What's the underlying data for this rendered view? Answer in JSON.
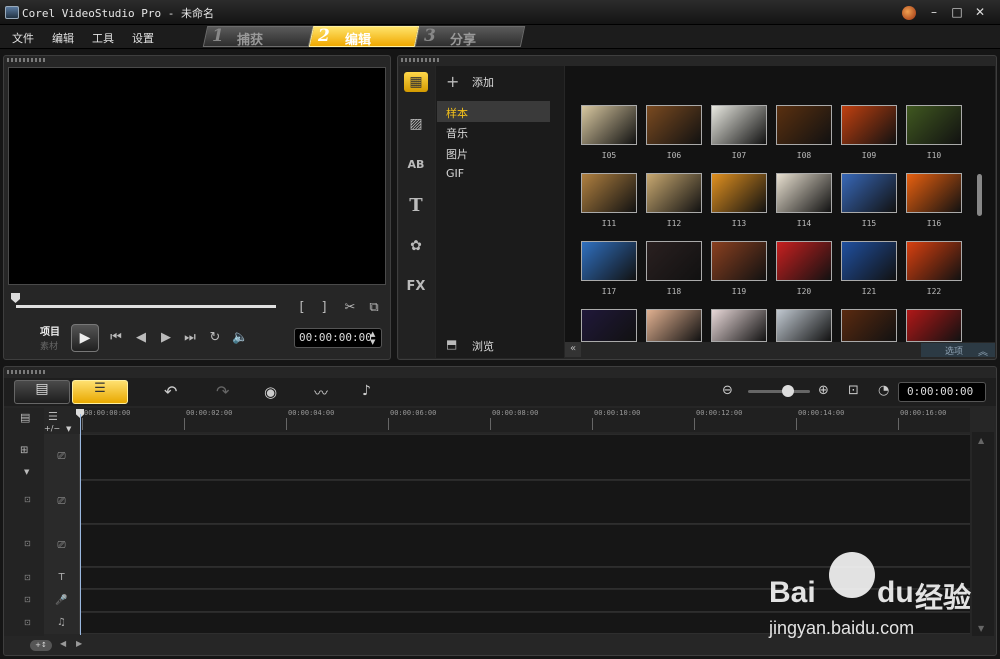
{
  "window": {
    "title": "Corel VideoStudio Pro - 未命名",
    "minimize": "–",
    "maximize": "□",
    "close": "✕"
  },
  "menu": [
    "文件",
    "编辑",
    "工具",
    "设置"
  ],
  "steps": [
    {
      "num": "1",
      "label": "捕获",
      "active": false
    },
    {
      "num": "2",
      "label": "编辑",
      "active": true
    },
    {
      "num": "3",
      "label": "分享",
      "active": false
    }
  ],
  "preview": {
    "mode_project": "项目",
    "mode_clip": "素材",
    "timecode": "00:00:00:00",
    "icons": [
      "play-icon",
      "home-icon",
      "prev-frame-icon",
      "next-frame-icon",
      "end-icon",
      "repeat-icon",
      "volume-icon",
      "mark-in-icon",
      "mark-out-icon",
      "split-icon",
      "copy-icon"
    ]
  },
  "library": {
    "add_label": "添加",
    "browse_label": "浏览",
    "options_label": "选项",
    "items": [
      "样本",
      "音乐",
      "图片",
      "GIF"
    ],
    "selected_item": "样本",
    "side_icons": [
      "media-icon",
      "transition-icon",
      "title-ab-icon",
      "text-t-icon",
      "graphic-icon",
      "fx-icon"
    ],
    "thumbnails": [
      {
        "label": "I05",
        "color": "#d8c8a0"
      },
      {
        "label": "I06",
        "color": "#7a4a20"
      },
      {
        "label": "I07",
        "color": "#e8e8e0"
      },
      {
        "label": "I08",
        "color": "#5a3010"
      },
      {
        "label": "I09",
        "color": "#c04010"
      },
      {
        "label": "I10",
        "color": "#405820"
      },
      {
        "label": "I11",
        "color": "#b08040"
      },
      {
        "label": "I12",
        "color": "#c8a870"
      },
      {
        "label": "I13",
        "color": "#e09020"
      },
      {
        "label": "I14",
        "color": "#e8e0d0"
      },
      {
        "label": "I15",
        "color": "#3868b8"
      },
      {
        "label": "I16",
        "color": "#e86010"
      },
      {
        "label": "I17",
        "color": "#3070c0"
      },
      {
        "label": "I18",
        "color": "#2a2020"
      },
      {
        "label": "I19",
        "color": "#8a4020"
      },
      {
        "label": "I20",
        "color": "#c82020"
      },
      {
        "label": "I21",
        "color": "#2050a0"
      },
      {
        "label": "I22",
        "color": "#d84010"
      },
      {
        "label": "",
        "color": "#20183a"
      },
      {
        "label": "",
        "color": "#e0b090"
      },
      {
        "label": "",
        "color": "#e8d8d8"
      },
      {
        "label": "",
        "color": "#c0c8d0"
      },
      {
        "label": "",
        "color": "#5a2a10"
      },
      {
        "label": "",
        "color": "#b01818"
      }
    ]
  },
  "timeline": {
    "timecode": "0:00:00:00",
    "ruler": [
      "00:00:00:00",
      "00:00:02:00",
      "00:00:04:00",
      "00:00:06:00",
      "00:00:08:00",
      "00:00:10:00",
      "00:00:12:00",
      "00:00:14:00",
      "00:00:16:00"
    ],
    "add_remove": "+/−",
    "track_names": [
      "video-track",
      "overlay-track-1",
      "overlay-track-2",
      "title-track",
      "voice-track",
      "music-track"
    ]
  },
  "watermark": {
    "brand": "Bai",
    "brand2": "du",
    "cn": "经验",
    "url": "jingyan.baidu.com"
  },
  "colors": {
    "accent": "#f5c21a",
    "panel": "#262626",
    "background": "#151515"
  }
}
